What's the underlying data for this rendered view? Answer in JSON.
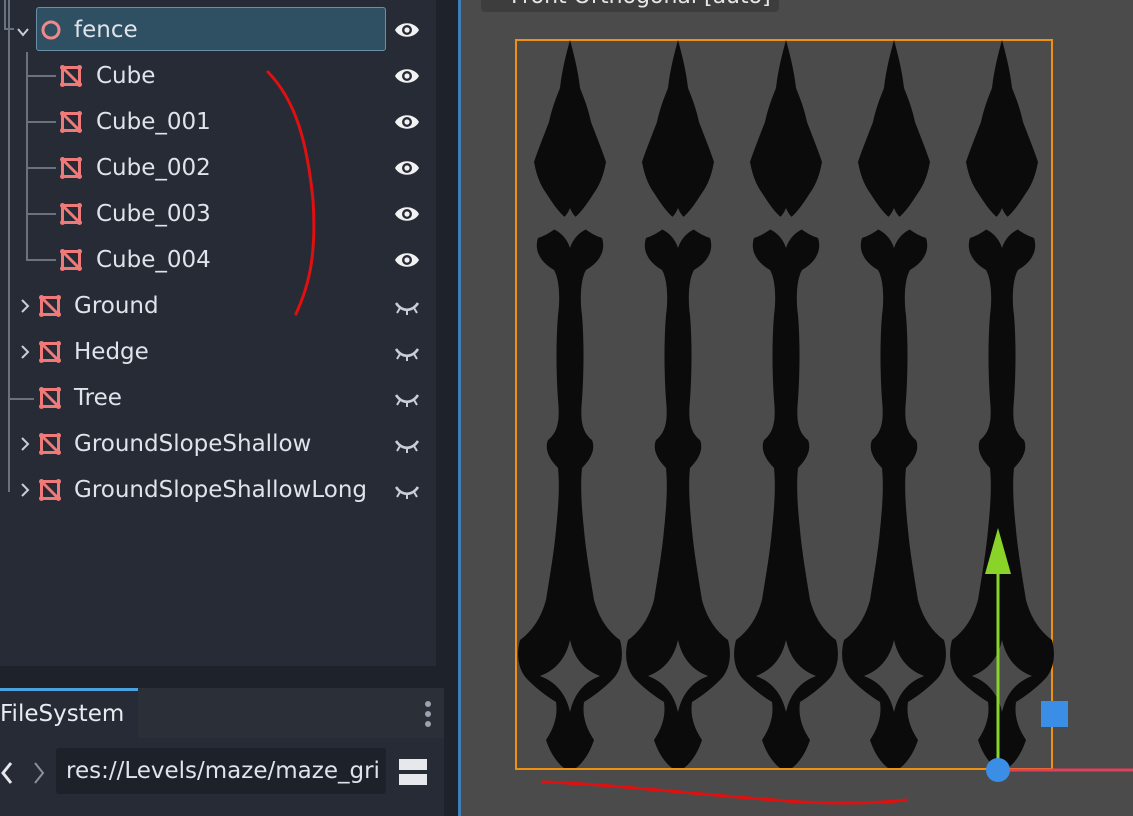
{
  "scene_tree": {
    "root": {
      "name": "fence",
      "visible": true
    },
    "children": [
      {
        "name": "Cube",
        "visible": true
      },
      {
        "name": "Cube_001",
        "visible": true
      },
      {
        "name": "Cube_002",
        "visible": true
      },
      {
        "name": "Cube_003",
        "visible": true
      },
      {
        "name": "Cube_004",
        "visible": true
      }
    ],
    "siblings": [
      {
        "name": "Ground",
        "expandable": true
      },
      {
        "name": "Hedge",
        "expandable": true
      },
      {
        "name": "Tree",
        "expandable": false
      },
      {
        "name": "GroundSlopeShallow",
        "expandable": true
      },
      {
        "name": "GroundSlopeShallowLong",
        "expandable": true
      }
    ]
  },
  "filesystem": {
    "tab_label": "FileSystem",
    "path": "res://Levels/maze/maze_gri"
  },
  "viewport": {
    "label": "Front Orthogonal [auto]"
  },
  "colors": {
    "node_icon": "#f07a7a",
    "root_icon": "#f08a8a",
    "selection": "#2f4f62",
    "viewport_bg": "#4b4b4b",
    "gizmo_y": "#8ad42a",
    "gizmo_x": "#e0405a",
    "gizmo_z": "#3a8ee6",
    "bounds": "#f0900f",
    "annotation": "#e01010"
  }
}
